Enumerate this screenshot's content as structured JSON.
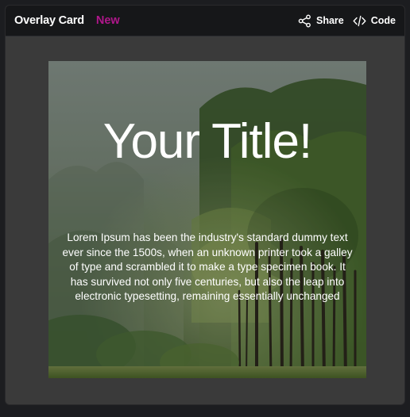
{
  "header": {
    "title": "Overlay Card",
    "badge": "New",
    "actions": [
      {
        "label": "Share",
        "icon": "share-icon"
      },
      {
        "label": "Code",
        "icon": "code-icon"
      }
    ]
  },
  "card": {
    "title": "Your Title!",
    "body": "Lorem Ipsum has been the industry's standard dummy text ever since the 1500s, when an unknown printer took a galley of type and scrambled it to make a type specimen book. It has survived not only five centuries, but also the leap into electronic typesetting, remaining essentially unchanged"
  },
  "colors": {
    "badge": "#b0178b",
    "header_bg": "#161719",
    "canvas_bg": "#3a3a3a"
  }
}
